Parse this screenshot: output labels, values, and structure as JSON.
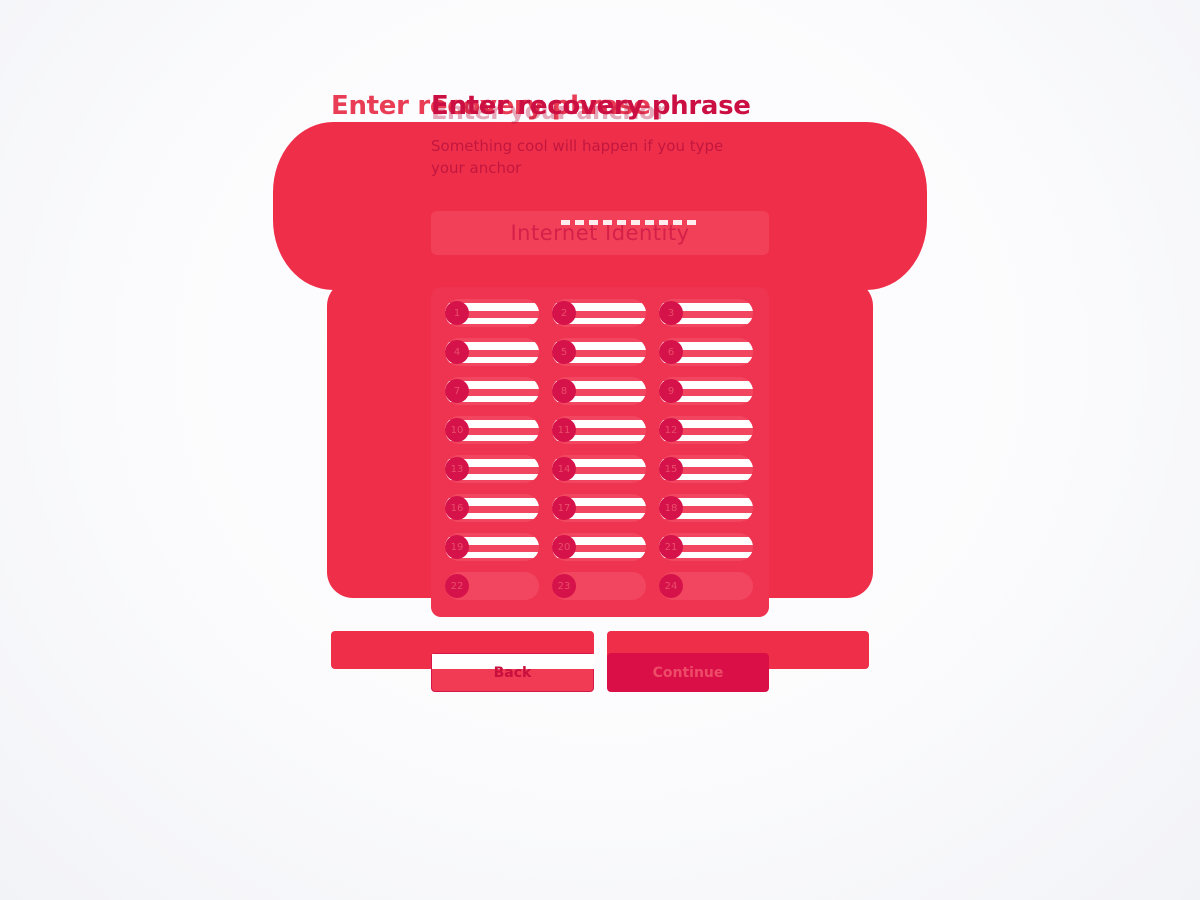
{
  "dialog": {
    "title": "Enter recovery phrase",
    "title_echo": "Enter your anchor",
    "subtitle": "Something cool will happen if you type your anchor",
    "anchor_field": {
      "value": "Internet Identity"
    },
    "words": [
      {
        "number": "1",
        "value": ""
      },
      {
        "number": "2",
        "value": ""
      },
      {
        "number": "3",
        "value": ""
      },
      {
        "number": "4",
        "value": ""
      },
      {
        "number": "5",
        "value": ""
      },
      {
        "number": "6",
        "value": ""
      },
      {
        "number": "7",
        "value": ""
      },
      {
        "number": "8",
        "value": ""
      },
      {
        "number": "9",
        "value": ""
      },
      {
        "number": "10",
        "value": ""
      },
      {
        "number": "11",
        "value": ""
      },
      {
        "number": "12",
        "value": ""
      },
      {
        "number": "13",
        "value": ""
      },
      {
        "number": "14",
        "value": ""
      },
      {
        "number": "15",
        "value": ""
      },
      {
        "number": "16",
        "value": ""
      },
      {
        "number": "17",
        "value": ""
      },
      {
        "number": "18",
        "value": ""
      },
      {
        "number": "19",
        "value": ""
      },
      {
        "number": "20",
        "value": ""
      },
      {
        "number": "21",
        "value": ""
      },
      {
        "number": "22",
        "value": ""
      },
      {
        "number": "23",
        "value": ""
      },
      {
        "number": "24",
        "value": ""
      }
    ],
    "buttons": {
      "back": "Back",
      "continue": "Continue"
    }
  },
  "colors": {
    "accent": "#ef2f4a",
    "primary": "#da0f47",
    "text": "#cc0f42"
  }
}
